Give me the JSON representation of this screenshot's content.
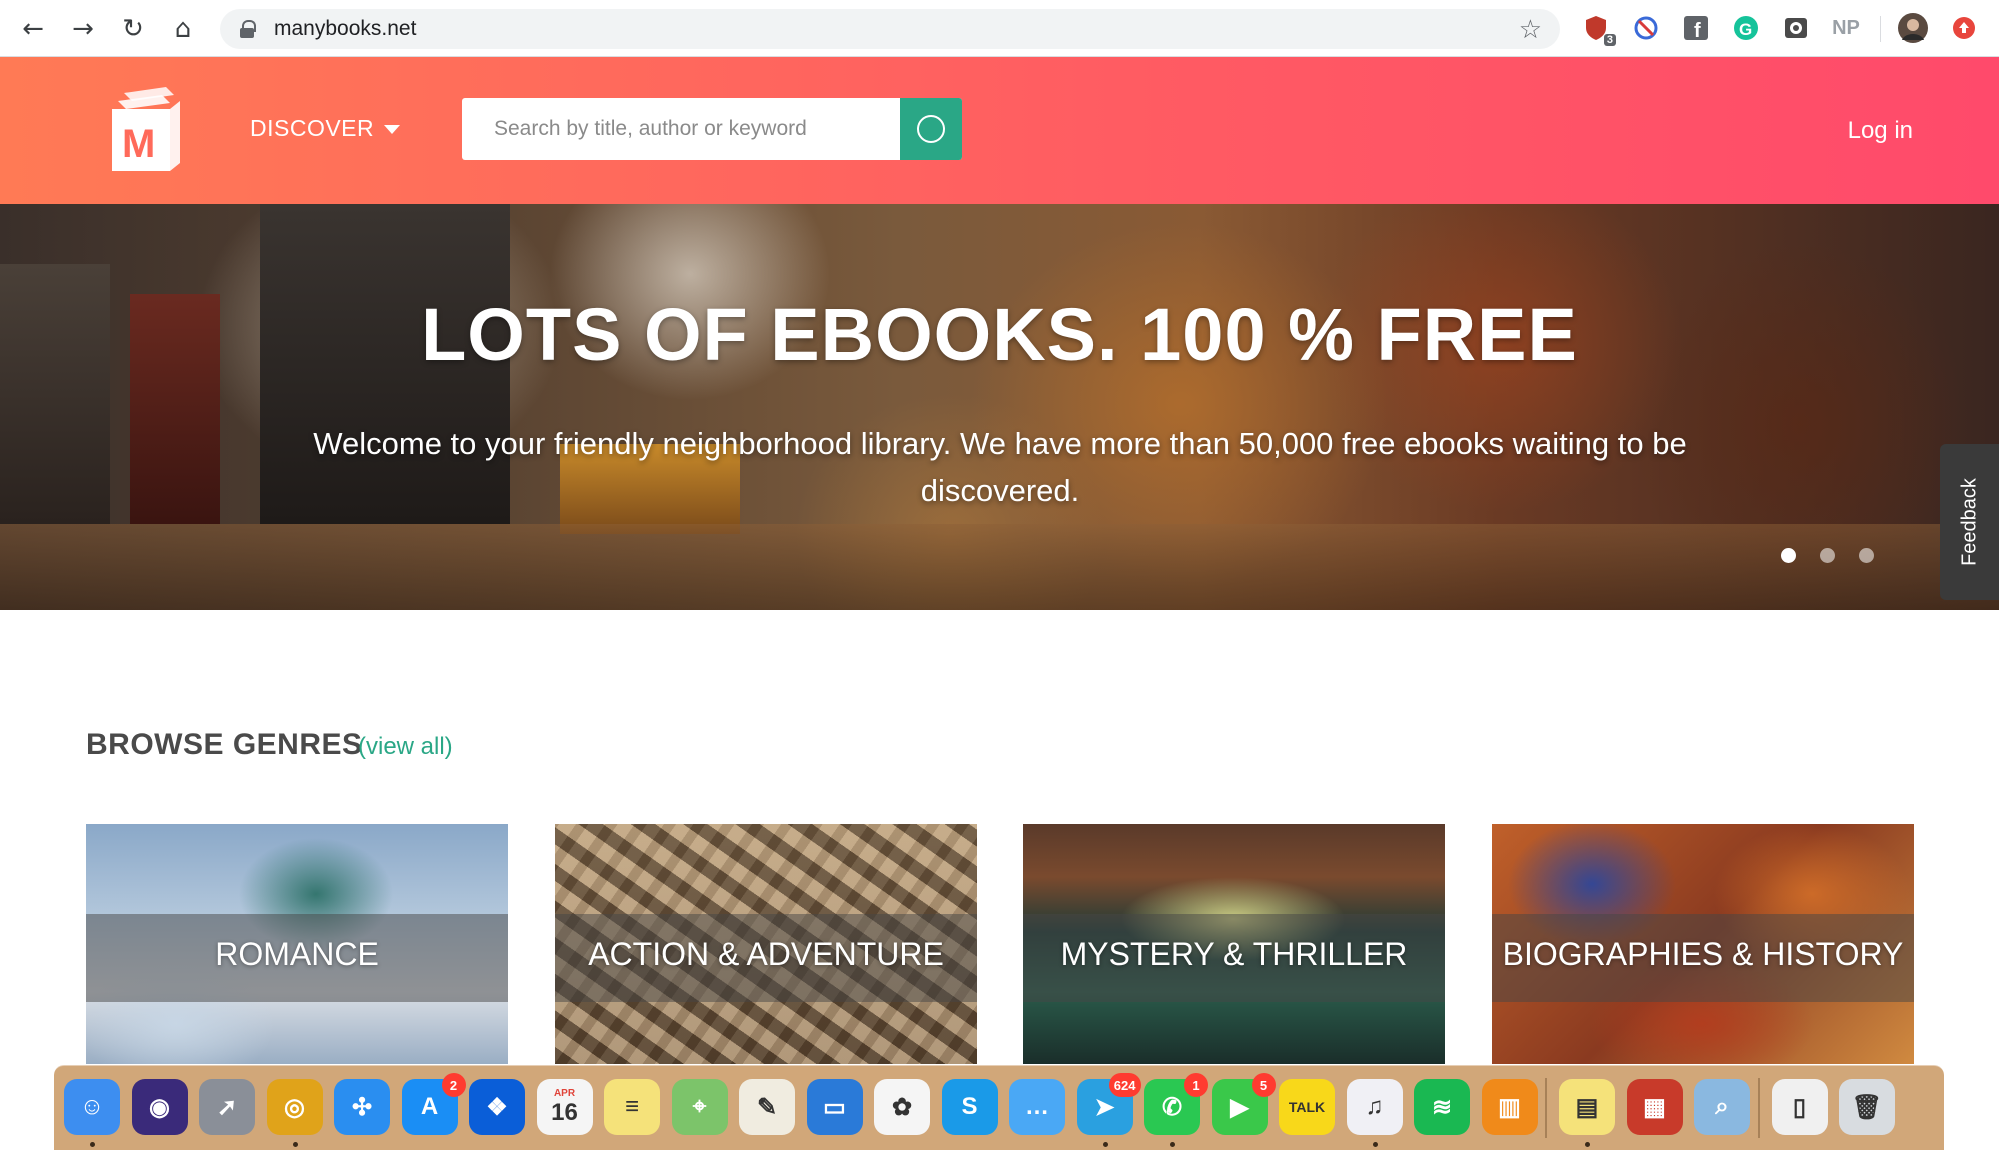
{
  "browser": {
    "url": "manybooks.net",
    "extensions": [
      "shield-ext",
      "block-ext",
      "facebook-ext",
      "grammarly-ext",
      "camera-ext",
      "NP",
      "profile-avatar",
      "update-ext"
    ],
    "ext_badge": "3",
    "np_label": "NP"
  },
  "header": {
    "logo_letter": "M",
    "discover_label": "DISCOVER",
    "search_placeholder": "Search by title, author or keyword",
    "login_label": "Log in",
    "brand_gradient": [
      "#ff7a55",
      "#ff4a6b"
    ],
    "search_button_color": "#2aa786"
  },
  "hero": {
    "title": "LOTS OF EBOOKS. 100 % FREE",
    "subtitle": "Welcome to your friendly neighborhood library. We have more than 50,000 free ebooks waiting to be discovered.",
    "slide_count": 3,
    "active_slide": 1
  },
  "feedback_label": "Feedback",
  "genres": {
    "heading": "BROWSE GENRES",
    "view_all": "(view all)",
    "items": [
      {
        "label": "ROMANCE"
      },
      {
        "label": "ACTION & ADVENTURE"
      },
      {
        "label": "MYSTERY & THRILLER"
      },
      {
        "label": "BIOGRAPHIES & HISTORY"
      }
    ]
  },
  "dock": {
    "apps": [
      {
        "name": "finder",
        "color": "#3d8ef0",
        "glyph": "☺",
        "running": true
      },
      {
        "name": "siri",
        "color": "#3a2a7a",
        "glyph": "◉",
        "running": false
      },
      {
        "name": "launchpad",
        "color": "#8a8f98",
        "glyph": "➚",
        "running": false
      },
      {
        "name": "chrome",
        "color": "#e0a31a",
        "glyph": "◎",
        "running": true
      },
      {
        "name": "safari",
        "color": "#2a8ef0",
        "glyph": "✣",
        "running": false
      },
      {
        "name": "app-store",
        "color": "#1a8ef5",
        "glyph": "A",
        "badge": "2",
        "running": false
      },
      {
        "name": "dropbox",
        "color": "#0a5ed8",
        "glyph": "❖",
        "running": false
      },
      {
        "name": "calendar",
        "color": "#f5f5f5",
        "glyph": "16",
        "month": "APR",
        "running": false
      },
      {
        "name": "notes",
        "color": "#f5e27a",
        "glyph": "≡",
        "running": false
      },
      {
        "name": "maps",
        "color": "#7cc46a",
        "glyph": "⌖",
        "running": false
      },
      {
        "name": "textedit",
        "color": "#f0ece0",
        "glyph": "✎",
        "running": false
      },
      {
        "name": "keynote",
        "color": "#2a7ad8",
        "glyph": "▭",
        "running": false
      },
      {
        "name": "photos",
        "color": "#f5f5f5",
        "glyph": "✿",
        "running": false
      },
      {
        "name": "skype",
        "color": "#1a9ae8",
        "glyph": "S",
        "running": false
      },
      {
        "name": "messages",
        "color": "#4aa8f5",
        "glyph": "…",
        "running": false
      },
      {
        "name": "telegram",
        "color": "#2aa0e0",
        "glyph": "➤",
        "badge": "624",
        "running": true
      },
      {
        "name": "whatsapp",
        "color": "#2ac852",
        "glyph": "✆",
        "badge": "1",
        "running": true
      },
      {
        "name": "facetime",
        "color": "#3ac84a",
        "glyph": "▶",
        "badge": "5",
        "running": false
      },
      {
        "name": "kakaotalk",
        "color": "#f8d81a",
        "glyph": "TALK",
        "running": false
      },
      {
        "name": "itunes",
        "color": "#f0f0f5",
        "glyph": "♫",
        "running": true
      },
      {
        "name": "spotify",
        "color": "#1ab852",
        "glyph": "≋",
        "running": false
      },
      {
        "name": "books",
        "color": "#f08a1a",
        "glyph": "▥",
        "running": false
      },
      {
        "name": "stickies",
        "color": "#f5e27a",
        "glyph": "▤",
        "running": true
      },
      {
        "name": "photo-booth",
        "color": "#c83a2a",
        "glyph": "▦",
        "running": false
      },
      {
        "name": "preview",
        "color": "#8ab8e0",
        "glyph": "⌕",
        "running": false
      },
      {
        "name": "documents-stack",
        "color": "#f0f0f0",
        "glyph": "▯",
        "running": false
      },
      {
        "name": "trash",
        "color": "#d8dce0",
        "glyph": "🗑",
        "running": false
      }
    ]
  }
}
